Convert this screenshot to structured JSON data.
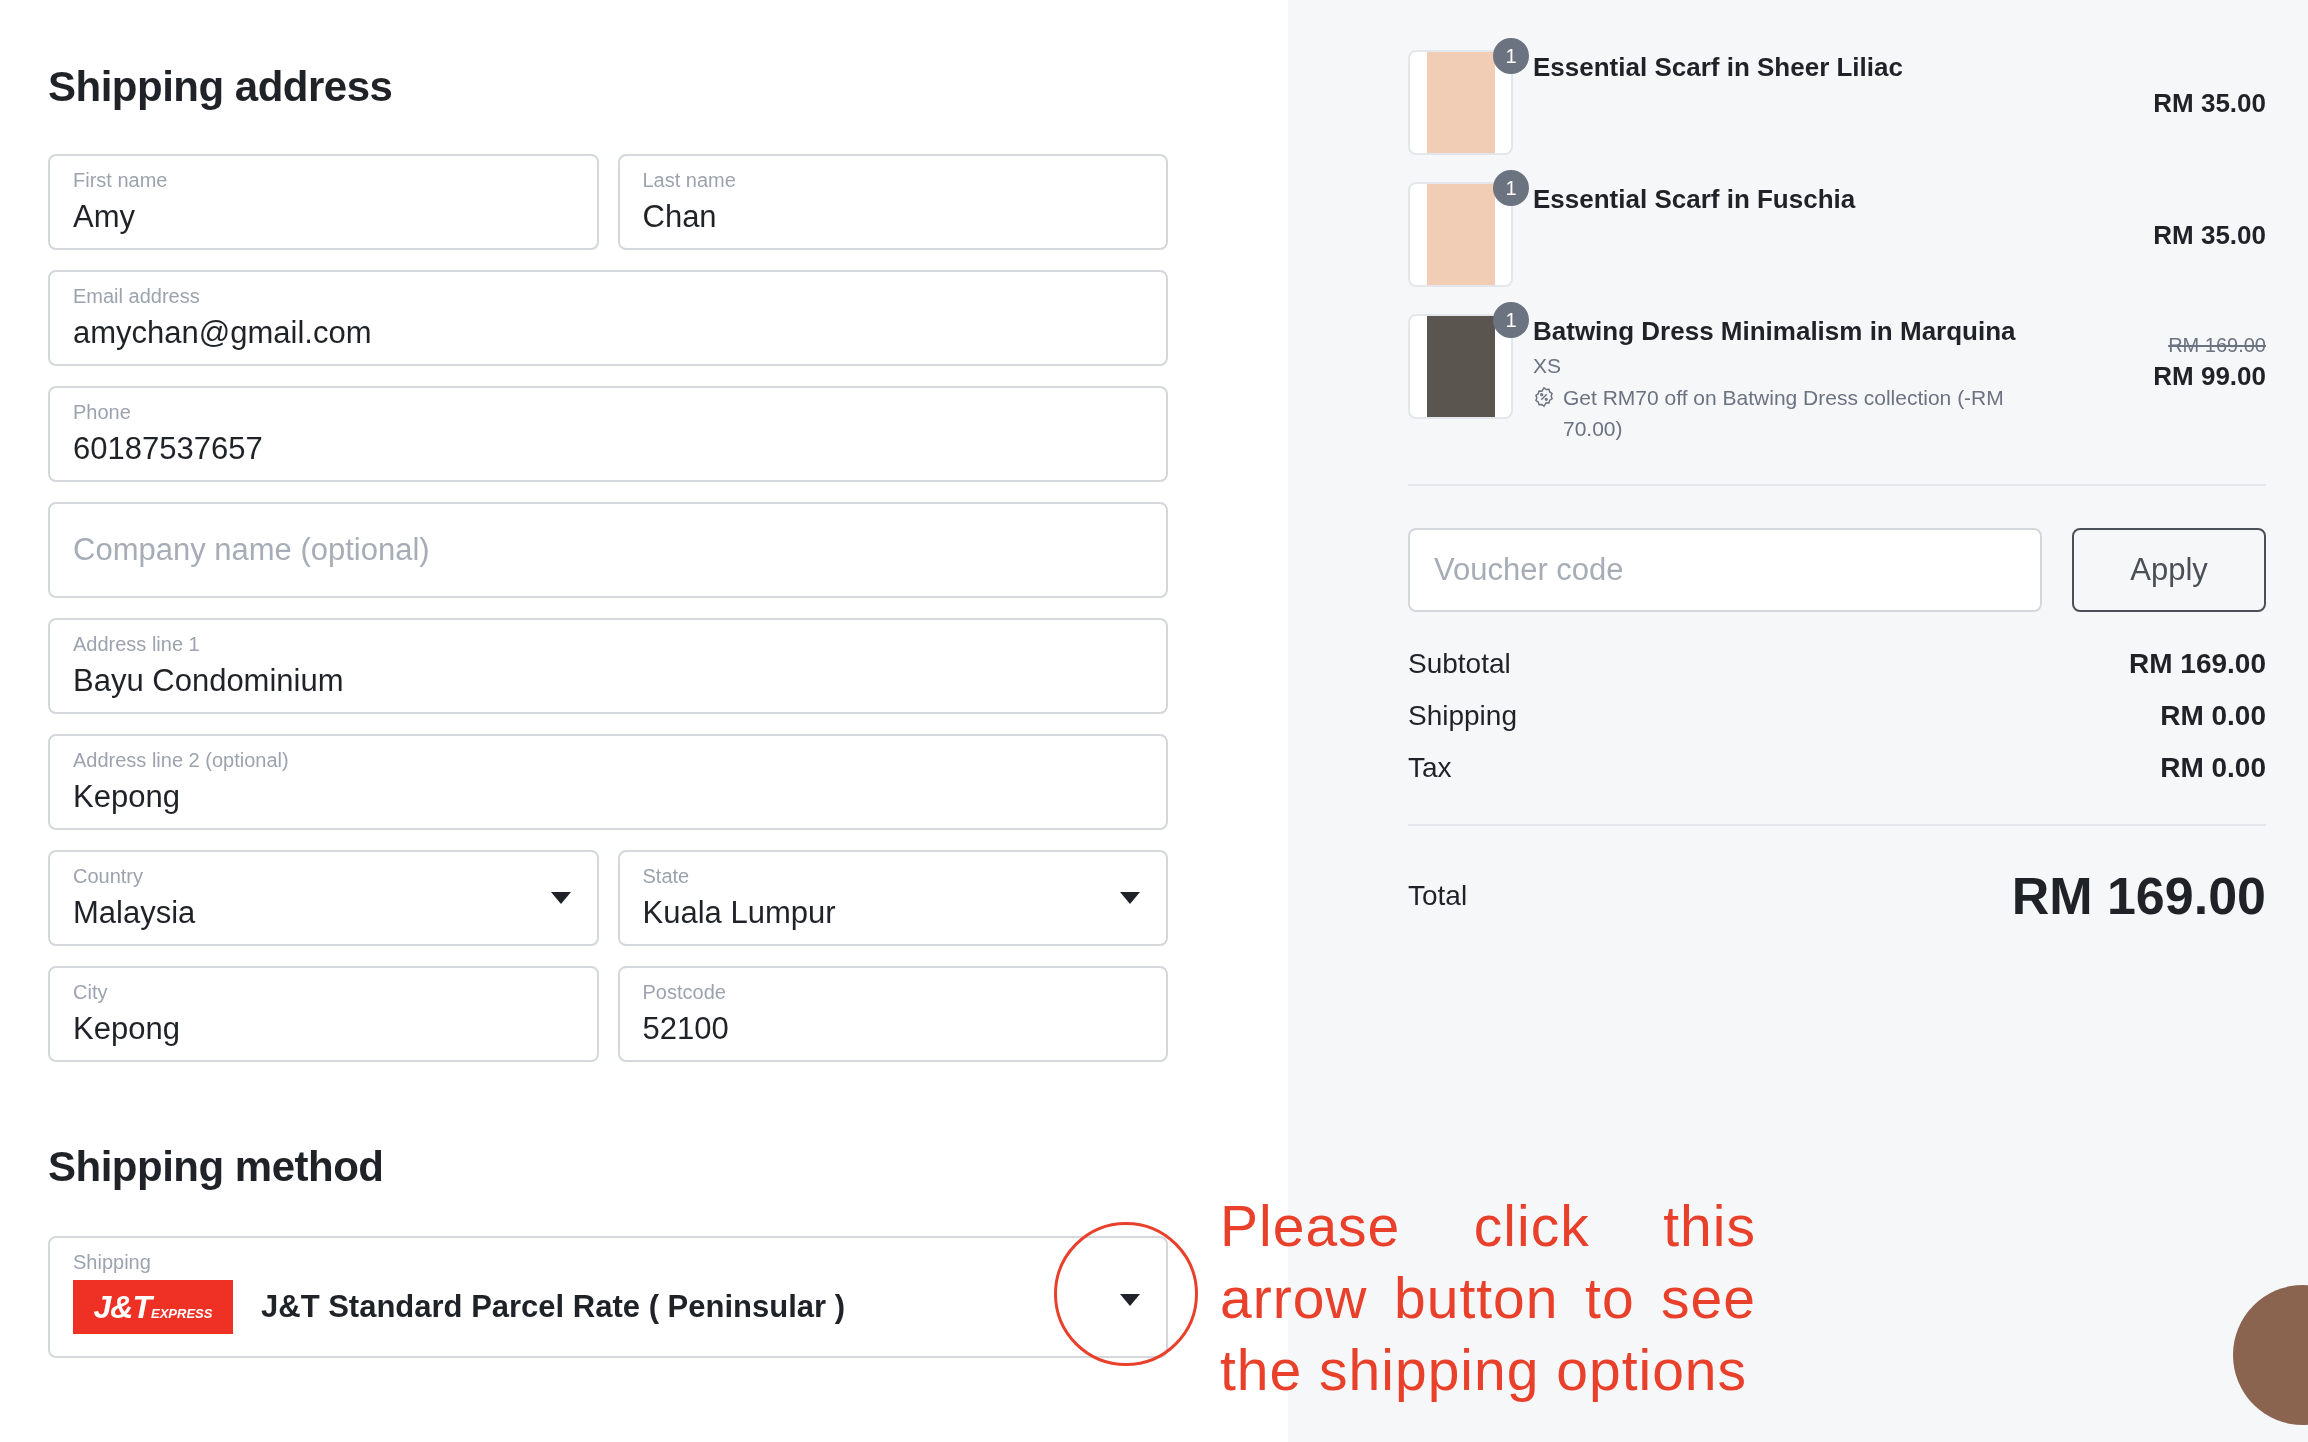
{
  "shipping_address": {
    "title": "Shipping address",
    "rows": [
      {
        "fields": [
          {
            "kind": "text",
            "label": "First name",
            "value": "Amy"
          },
          {
            "kind": "text",
            "label": "Last name",
            "value": "Chan"
          }
        ]
      },
      {
        "fields": [
          {
            "kind": "text",
            "label": "Email address",
            "value": "amychan@gmail.com"
          }
        ]
      },
      {
        "fields": [
          {
            "kind": "text",
            "label": "Phone",
            "value": "60187537657"
          }
        ]
      },
      {
        "fields": [
          {
            "kind": "empty",
            "placeholder": "Company name (optional)"
          }
        ]
      },
      {
        "fields": [
          {
            "kind": "text",
            "label": "Address line 1",
            "value": "Bayu Condominium"
          }
        ]
      },
      {
        "fields": [
          {
            "kind": "text",
            "label": "Address line 2 (optional)",
            "value": "Kepong"
          }
        ]
      },
      {
        "fields": [
          {
            "kind": "select",
            "label": "Country",
            "value": "Malaysia"
          },
          {
            "kind": "select",
            "label": "State",
            "value": "Kuala Lumpur"
          }
        ]
      },
      {
        "fields": [
          {
            "kind": "text",
            "label": "City",
            "value": "Kepong"
          },
          {
            "kind": "text",
            "label": "Postcode",
            "value": "52100"
          }
        ]
      }
    ]
  },
  "shipping_method": {
    "title": "Shipping method",
    "label": "Shipping",
    "logo": {
      "main": "J&T",
      "sub": "EXPRESS"
    },
    "value": "J&T Standard Parcel Rate ( Peninsular )"
  },
  "annotation": {
    "text": "Please click this arrow button to see the shipping options"
  },
  "cart_items": [
    {
      "name": "Essential Scarf in Sheer Liliac",
      "quantity": "1",
      "price": "RM 35.00"
    },
    {
      "name": "Essential Scarf in Fuschia",
      "quantity": "1",
      "price": "RM 35.00"
    },
    {
      "name": "Batwing Dress Minimalism in Marquina",
      "quantity": "1",
      "variant": "XS",
      "discount": "Get RM70 off on Batwing Dress collection (-RM 70.00)",
      "original_price": "RM 169.00",
      "price": "RM 99.00"
    }
  ],
  "voucher": {
    "placeholder": "Voucher code",
    "button": "Apply"
  },
  "summary": [
    {
      "label": "Subtotal",
      "value": "RM 169.00"
    },
    {
      "label": "Shipping",
      "value": "RM 0.00"
    },
    {
      "label": "Tax",
      "value": "RM 0.00"
    }
  ],
  "total": {
    "label": "Total",
    "value": "RM 169.00"
  }
}
